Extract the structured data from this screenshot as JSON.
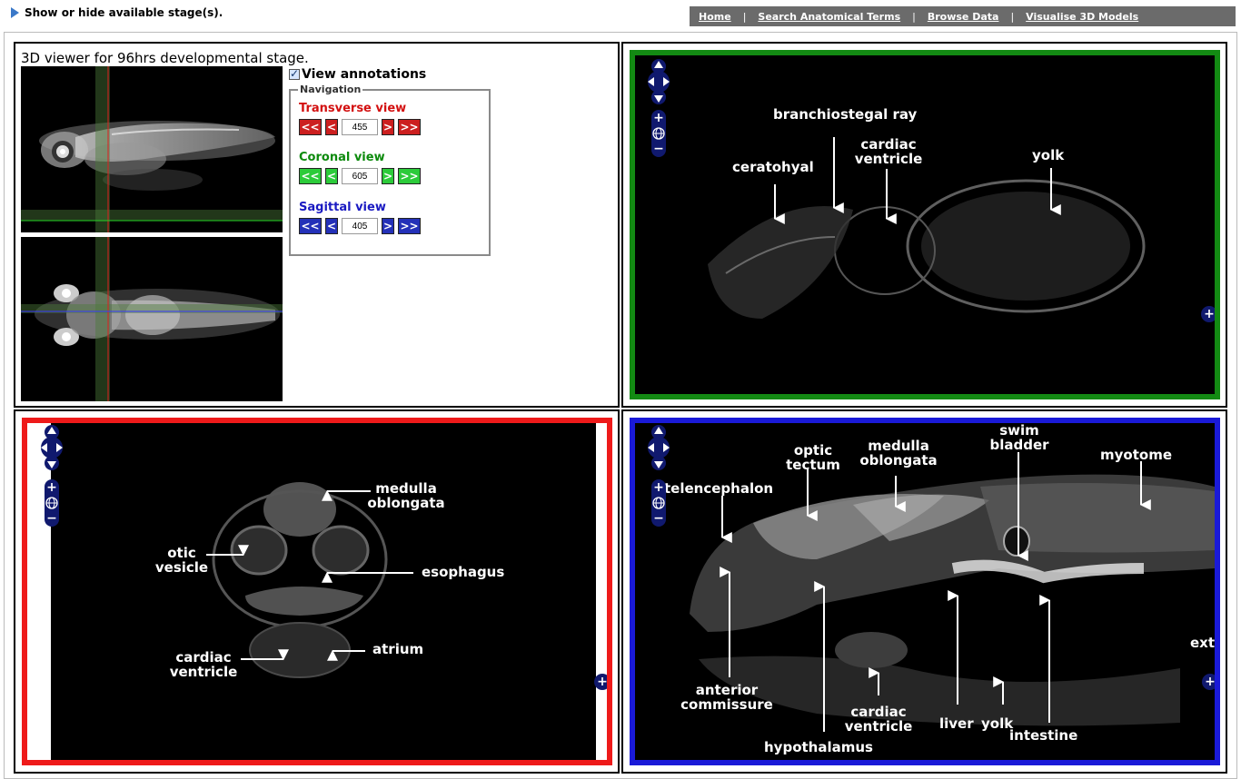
{
  "header": {
    "stage_toggle": "Show or hide available stage(s).",
    "nav": [
      "Home",
      "Search Anatomical Terms",
      "Browse Data",
      "Visualise 3D Models"
    ]
  },
  "viewer": {
    "title": "3D viewer for 96hrs developmental stage.",
    "annotations_label": "View annotations",
    "annotations_checked": true,
    "navigation_legend": "Navigation",
    "transverse": {
      "label": "Transverse view",
      "value": "455",
      "color": "#cc1f1f"
    },
    "coronal": {
      "label": "Coronal view",
      "value": "605",
      "color": "#2ccb3a"
    },
    "sagittal": {
      "label": "Sagittal view",
      "value": "405",
      "color": "#2431b8"
    },
    "buttons": {
      "first": "<<",
      "prev": "<",
      "next": ">",
      "last": ">>"
    }
  },
  "coronal_panel": {
    "labels": [
      "branchiostegal ray",
      "cardiac ventricle",
      "ceratohyal",
      "yolk"
    ]
  },
  "transverse_panel": {
    "labels": [
      "medulla oblongata",
      "otic vesicle",
      "esophagus",
      "cardiac ventricle",
      "atrium"
    ]
  },
  "sagittal_panel": {
    "labels": [
      "swim bladder",
      "optic tectum",
      "medulla oblongata",
      "myotome",
      "telencephalon",
      "anterior commissure",
      "hypothalamus",
      "cardiac ventricle",
      "liver",
      "yolk",
      "intestine",
      "ext"
    ]
  },
  "icons": {
    "pan": "pan-arrows-icon",
    "zoom_in": "zoom-in-icon",
    "zoom_out": "zoom-out-icon",
    "globe": "globe-icon",
    "expand": "expand-plus-icon"
  }
}
